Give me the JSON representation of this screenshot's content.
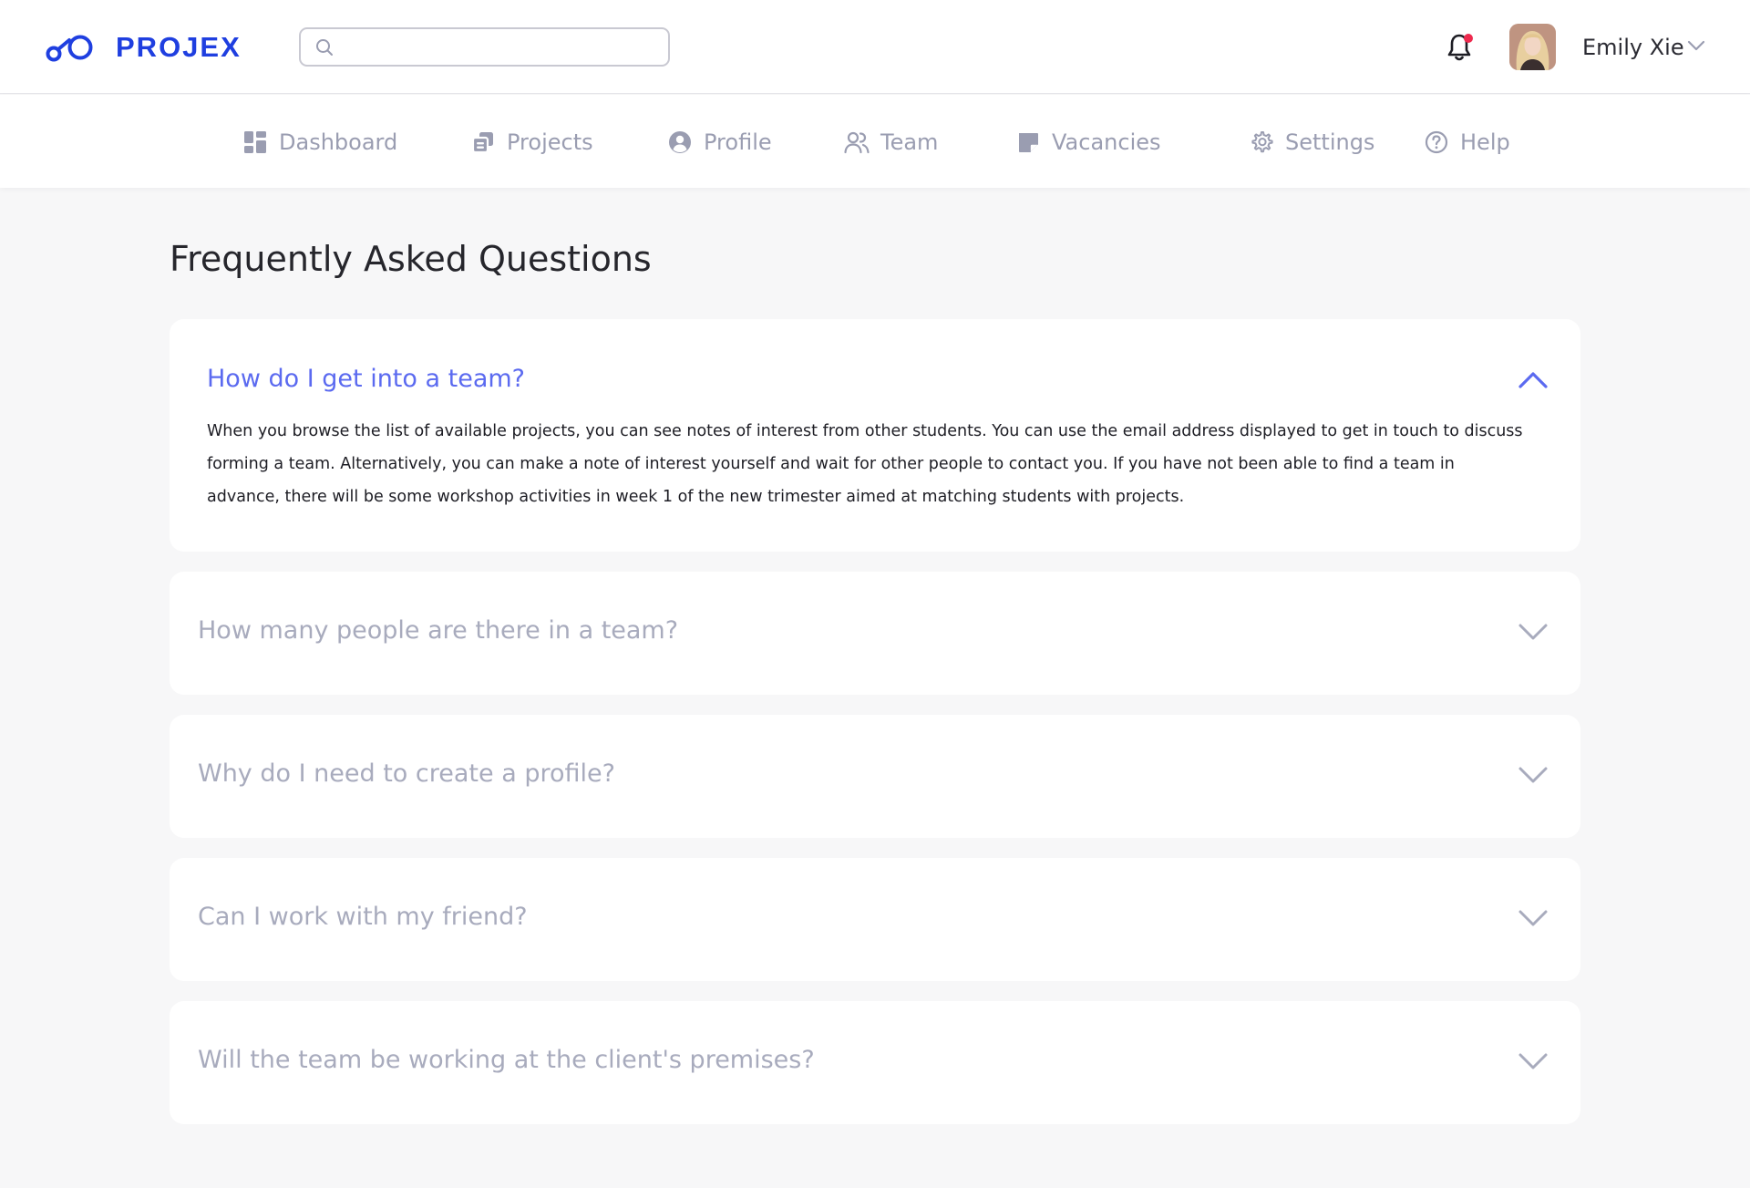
{
  "brand": {
    "name": "PROJEX",
    "color": "#1f3fe0"
  },
  "search": {
    "placeholder": "",
    "value": ""
  },
  "header": {
    "notifications_icon": "bell-icon",
    "has_unread": true,
    "user_name": "Emily Xie"
  },
  "nav": {
    "items": [
      {
        "label": "Dashboard",
        "icon": "dashboard-icon"
      },
      {
        "label": "Projects",
        "icon": "projects-icon"
      },
      {
        "label": "Profile",
        "icon": "profile-icon"
      },
      {
        "label": "Team",
        "icon": "team-icon"
      },
      {
        "label": "Vacancies",
        "icon": "vacancies-icon"
      },
      {
        "label": "Settings",
        "icon": "settings-icon"
      },
      {
        "label": "Help",
        "icon": "help-icon"
      }
    ]
  },
  "page": {
    "title": "Frequently Asked Questions"
  },
  "faq": [
    {
      "question": "How do I get into a team?",
      "expanded": true,
      "answer": "When you browse the list of available projects, you can see notes of interest from other students. You can use the email address displayed to get in touch to discuss forming a team. Alternatively, you can make a note of interest yourself and wait for other people to contact you. If you have not been able to find a team in advance, there will be some workshop activities in week 1 of the new trimester aimed at matching students with projects."
    },
    {
      "question": "How many people are there in a team?",
      "expanded": false
    },
    {
      "question": "Why do I need to create a profile?",
      "expanded": false
    },
    {
      "question": "Can I work with my friend?",
      "expanded": false
    },
    {
      "question": "Will the team be working at the client's premises?",
      "expanded": false
    }
  ],
  "colors": {
    "accent": "#5b6af0",
    "muted": "#9a9db1",
    "background": "#f7f7f8",
    "notification_dot": "#ee2a4e"
  }
}
